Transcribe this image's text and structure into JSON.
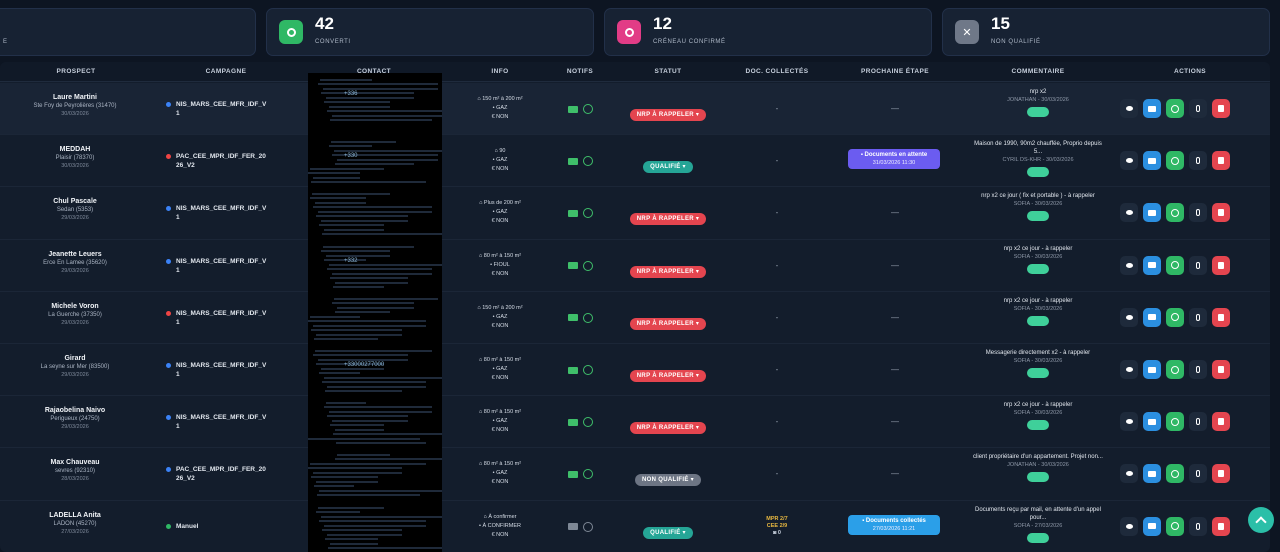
{
  "stats": [
    {
      "value": "",
      "label": "E",
      "color": "#2a3447"
    },
    {
      "value": "42",
      "label": "CONVERTI",
      "color": "#2fb865"
    },
    {
      "value": "12",
      "label": "CRÉNEAU CONFIRMÉ",
      "color": "#e23c86"
    },
    {
      "value": "15",
      "label": "NON QUALIFIÉ",
      "color": "#6f7888"
    }
  ],
  "columns": {
    "prospect": "PROSPECT",
    "campagne": "CAMPAGNE",
    "contact": "CONTACT",
    "info": "INFO",
    "notifs": "NOTIFS",
    "statut": "STATUT",
    "docs": "DOC. COLLECTÉS",
    "etape": "PROCHAINE ÉTAPE",
    "commentaire": "COMMENTAIRE",
    "actions": "ACTIONS"
  },
  "rows": [
    {
      "name": "Laure Martini",
      "location": "Ste Foy de Peyrolières (31470)",
      "date": "30/03/2026",
      "campaign": "NIS_MARS_CEE_MFR_IDF_V1",
      "campaign_color": "#3b82f6",
      "contact": "+336",
      "info": [
        "150 m² à 200 m²",
        "GAZ",
        "NON"
      ],
      "status": "NRP À RAPPELER",
      "status_color": "red",
      "docs": "-",
      "step": "—",
      "comment": "nrp x2",
      "comment_by": "JONATHAN - 30/03/2026"
    },
    {
      "name": "MEDDAH",
      "location": "Plaisir (78370)",
      "date": "30/03/2026",
      "campaign": "PAC_CEE_MPR_IDF_FER_2026_V2",
      "campaign_color": "#ef4444",
      "contact": "+330",
      "info": [
        "90",
        "GAZ",
        "NON"
      ],
      "status": "QUALIFIÉ",
      "status_color": "teal",
      "docs": "-",
      "step_title": "Documents en attente",
      "step_date": "31/03/2026 11:30",
      "comment": "Maison de 1990, 90m2 chauffée, Proprio depuis 5...",
      "comment_by": "CYRIL DS-KHR - 30/03/2026"
    },
    {
      "name": "Chul Pascale",
      "location": "Sedan (5353)",
      "date": "29/03/2026",
      "campaign": "NIS_MARS_CEE_MFR_IDF_V1",
      "campaign_color": "#3b82f6",
      "contact": "",
      "info": [
        "Plus de 200 m²",
        "GAZ",
        "NON"
      ],
      "status": "NRP À RAPPELER",
      "status_color": "red",
      "docs": "-",
      "step": "—",
      "comment": "nrp x2 ce jour ( fix et portable ) - à rappeler",
      "comment_by": "SOFIA - 30/03/2026"
    },
    {
      "name": "Jeanette Leuers",
      "location": "Erce En Lamee (35620)",
      "date": "29/03/2026",
      "campaign": "NIS_MARS_CEE_MFR_IDF_V1",
      "campaign_color": "#3b82f6",
      "contact": "+332",
      "info": [
        "80 m² à 150 m²",
        "FIOUL",
        "NON"
      ],
      "status": "NRP À RAPPELER",
      "status_color": "red",
      "docs": "-",
      "step": "—",
      "comment": "nrp x2 ce jour - à rappeler",
      "comment_by": "SOFIA - 30/03/2026"
    },
    {
      "name": "Michele Voron",
      "location": "La Guerche (37350)",
      "date": "29/03/2026",
      "campaign": "NIS_MARS_CEE_MFR_IDF_V1",
      "campaign_color": "#ef4444",
      "contact": "",
      "info": [
        "150 m² à 200 m²",
        "GAZ",
        "NON"
      ],
      "status": "NRP À RAPPELER",
      "status_color": "red",
      "docs": "-",
      "step": "—",
      "comment": "nrp x2 ce jour - à rappeler",
      "comment_by": "SOFIA - 30/03/2026"
    },
    {
      "name": "Girard",
      "location": "La seyne sur Mer (83500)",
      "date": "29/03/2026",
      "campaign": "NIS_MARS_CEE_MFR_IDF_V1",
      "campaign_color": "#3b82f6",
      "contact": "+33000277000",
      "info": [
        "80 m² à 150 m²",
        "GAZ",
        "NON"
      ],
      "status": "NRP À RAPPELER",
      "status_color": "red",
      "docs": "-",
      "step": "—",
      "comment": "Messagerie directement x2 - à rappeler",
      "comment_by": "SOFIA - 30/03/2026"
    },
    {
      "name": "Rajaobelina Naivo",
      "location": "Perigueux (24750)",
      "date": "29/03/2026",
      "campaign": "NIS_MARS_CEE_MFR_IDF_V1",
      "campaign_color": "#3b82f6",
      "contact": "",
      "info": [
        "80 m² à 150 m²",
        "GAZ",
        "NON"
      ],
      "status": "NRP À RAPPELER",
      "status_color": "red",
      "docs": "-",
      "step": "—",
      "comment": "nrp x2 ce jour - à rappeler",
      "comment_by": "SOFIA - 30/03/2026"
    },
    {
      "name": "Max Chauveau",
      "location": "sevres (92310)",
      "date": "28/03/2026",
      "campaign": "PAC_CEE_MPR_IDF_FER_2026_V2",
      "campaign_color": "#3b82f6",
      "contact": "",
      "info": [
        "80 m² à 150 m²",
        "GAZ",
        "NON"
      ],
      "status": "NON QUALIFIÉ",
      "status_color": "gray",
      "docs": "-",
      "step": "—",
      "comment": "client propriétaire d'un appartement. Projet non...",
      "comment_by": "JONATHAN - 30/03/2026"
    },
    {
      "name": "LADELLA Anita",
      "location": "LADON (45270)",
      "date": "27/03/2026",
      "campaign": "Manuel",
      "campaign_color": "#2fb865",
      "contact": "",
      "info": [
        "À confirmer",
        "À CONFIRMER",
        "NON"
      ],
      "status": "QUALIFIÉ",
      "status_color": "teal",
      "docs_lines": [
        "MPR 2/7",
        "CEE 2/9",
        "0"
      ],
      "step_title": "Documents collectés",
      "step_date": "27/03/2026 11:21",
      "comment": "Documents reçu par mail, en attente d'un appel pour...",
      "comment_by": "SOFIA - 27/03/2026"
    }
  ]
}
